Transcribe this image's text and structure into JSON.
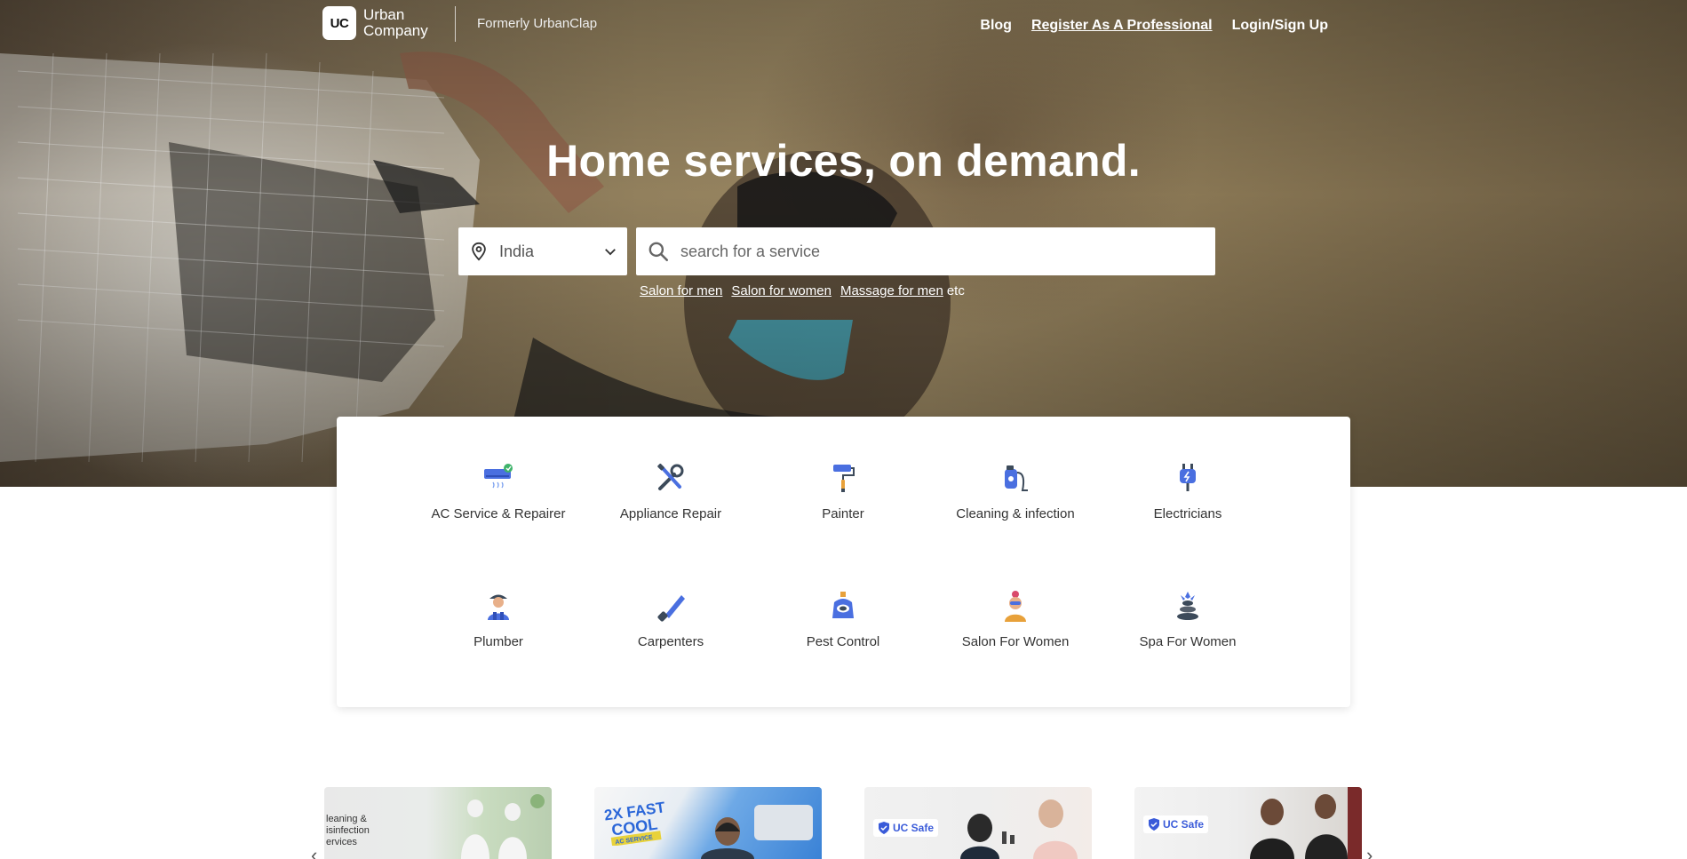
{
  "header": {
    "logo_badge": "UC",
    "logo_line1": "Urban",
    "logo_line2": "Company",
    "formerly": "Formerly UrbanClap",
    "nav": {
      "blog": "Blog",
      "register": "Register As A Professional",
      "login": "Login/Sign Up"
    }
  },
  "hero": {
    "headline": "Home services, on demand.",
    "location_value": "India",
    "search_placeholder": "search for a service",
    "suggestions": [
      "Salon for men",
      "Salon for women",
      "Massage for men"
    ],
    "suggestions_suffix": "etc"
  },
  "categories": [
    {
      "label": "AC Service & Repairer",
      "icon": "ac-icon"
    },
    {
      "label": "Appliance Repair",
      "icon": "tools-icon"
    },
    {
      "label": "Painter",
      "icon": "paint-roller-icon"
    },
    {
      "label": "Cleaning & infection",
      "icon": "vacuum-icon"
    },
    {
      "label": "Electricians",
      "icon": "plug-icon"
    },
    {
      "label": "Plumber",
      "icon": "plumber-icon"
    },
    {
      "label": "Carpenters",
      "icon": "saw-icon"
    },
    {
      "label": "Pest Control",
      "icon": "pest-icon"
    },
    {
      "label": "Salon For Women",
      "icon": "salon-woman-icon"
    },
    {
      "label": "Spa For Women",
      "icon": "spa-stones-icon"
    }
  ],
  "carousel": {
    "tile1_text": "leaning &\nisinfection\nervices",
    "tile2_text1": "2X FAST",
    "tile2_text2": "COOL",
    "tile2_text3": "AC SERVICE",
    "tile3_badge": "UC Safe",
    "tile4_badge": "UC Safe"
  },
  "colors": {
    "accent_blue": "#4a6fe0",
    "icon_dark": "#3c4a5a"
  }
}
